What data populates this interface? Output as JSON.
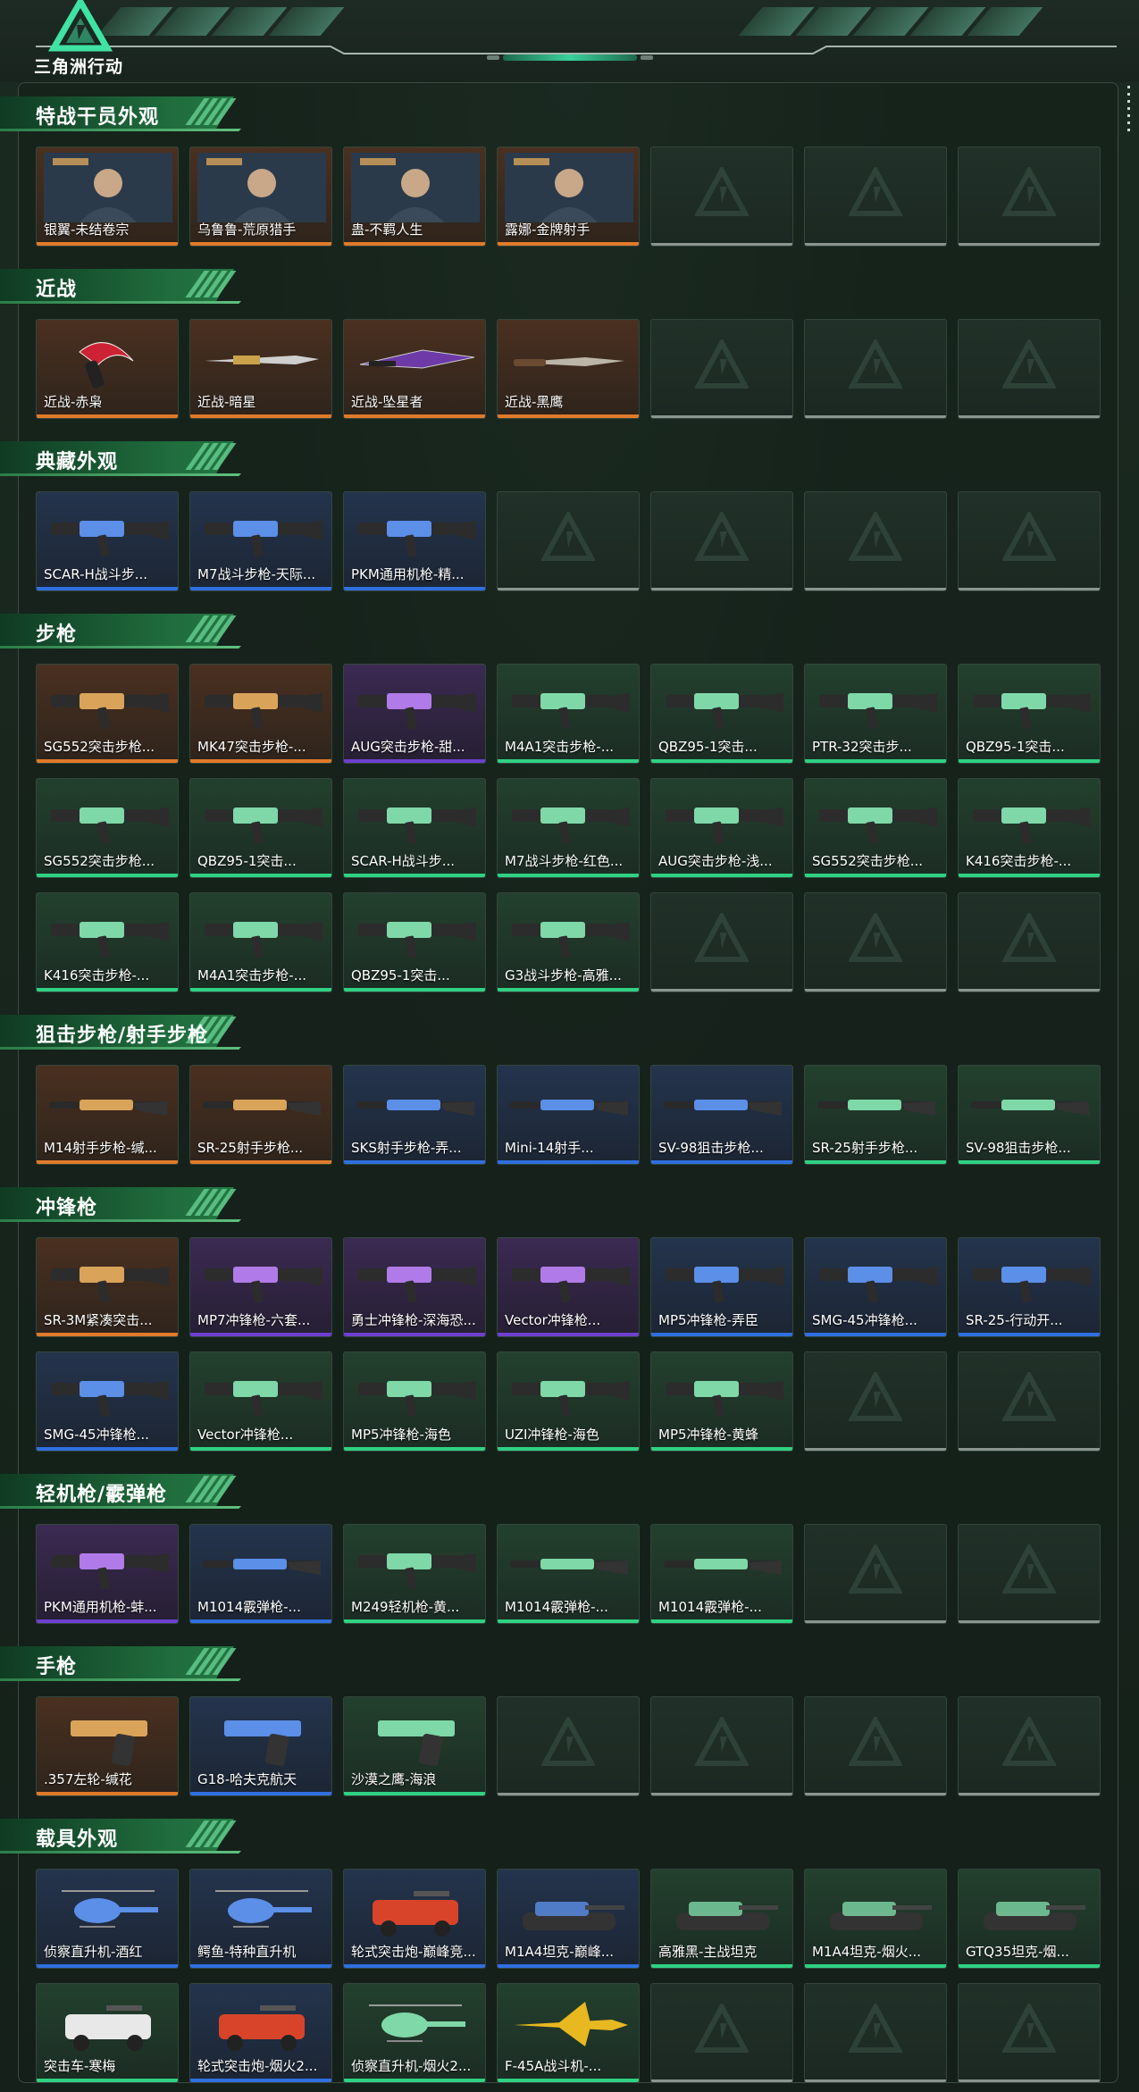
{
  "header": {
    "logo_text": "三角洲行动"
  },
  "colors": {
    "orange": "#e07a2a",
    "purple": "#6e3fd0",
    "blue": "#2f6fe0",
    "green": "#2fd183",
    "empty": "#8b9590",
    "accent": "#39d29c"
  },
  "sections": [
    {
      "title": "特战干员外观",
      "rows": 1,
      "items": [
        {
          "label": "银翼-未结卷宗",
          "rarity": "orange",
          "icon": "operator-portrait"
        },
        {
          "label": "乌鲁鲁-荒原猎手",
          "rarity": "orange",
          "icon": "operator-portrait"
        },
        {
          "label": "蛊-不羁人生",
          "rarity": "orange",
          "icon": "operator-portrait"
        },
        {
          "label": "露娜-金牌射手",
          "rarity": "orange",
          "icon": "operator-portrait"
        }
      ]
    },
    {
      "title": "近战",
      "rows": 1,
      "items": [
        {
          "label": "近战-赤枭",
          "rarity": "orange",
          "icon": "karambit-knife"
        },
        {
          "label": "近战-暗星",
          "rarity": "orange",
          "icon": "sword"
        },
        {
          "label": "近战-坠星者",
          "rarity": "orange",
          "icon": "blade"
        },
        {
          "label": "近战-黑鹰",
          "rarity": "orange",
          "icon": "combat-knife"
        }
      ]
    },
    {
      "title": "典藏外观",
      "rows": 1,
      "items": [
        {
          "label": "SCAR-H战斗步...",
          "rarity": "blue",
          "icon": "rifle"
        },
        {
          "label": "M7战斗步枪-天际...",
          "rarity": "blue",
          "icon": "rifle"
        },
        {
          "label": "PKM通用机枪-精...",
          "rarity": "blue",
          "icon": "machine-gun"
        }
      ]
    },
    {
      "title": "步枪",
      "rows": 3,
      "items": [
        {
          "label": "SG552突击步枪...",
          "rarity": "orange",
          "icon": "rifle"
        },
        {
          "label": "MK47突击步枪-...",
          "rarity": "orange",
          "icon": "rifle"
        },
        {
          "label": "AUG突击步枪-甜...",
          "rarity": "purple",
          "icon": "rifle"
        },
        {
          "label": "M4A1突击步枪-...",
          "rarity": "green",
          "icon": "rifle"
        },
        {
          "label": "QBZ95-1突击...",
          "rarity": "green",
          "icon": "rifle"
        },
        {
          "label": "PTR-32突击步...",
          "rarity": "green",
          "icon": "rifle"
        },
        {
          "label": "QBZ95-1突击...",
          "rarity": "green",
          "icon": "rifle"
        },
        {
          "label": "SG552突击步枪...",
          "rarity": "green",
          "icon": "rifle"
        },
        {
          "label": "QBZ95-1突击...",
          "rarity": "green",
          "icon": "rifle"
        },
        {
          "label": "SCAR-H战斗步...",
          "rarity": "green",
          "icon": "rifle"
        },
        {
          "label": "M7战斗步枪-红色...",
          "rarity": "green",
          "icon": "rifle"
        },
        {
          "label": "AUG突击步枪-浅...",
          "rarity": "green",
          "icon": "rifle"
        },
        {
          "label": "SG552突击步枪...",
          "rarity": "green",
          "icon": "rifle"
        },
        {
          "label": "K416突击步枪-...",
          "rarity": "green",
          "icon": "rifle"
        },
        {
          "label": "K416突击步枪-...",
          "rarity": "green",
          "icon": "rifle"
        },
        {
          "label": "M4A1突击步枪-...",
          "rarity": "green",
          "icon": "rifle"
        },
        {
          "label": "QBZ95-1突击...",
          "rarity": "green",
          "icon": "rifle"
        },
        {
          "label": "G3战斗步枪-高雅...",
          "rarity": "green",
          "icon": "rifle"
        }
      ]
    },
    {
      "title": "狙击步枪/射手步枪",
      "rows": 1,
      "items": [
        {
          "label": "M14射手步枪-缄...",
          "rarity": "orange",
          "icon": "marksman-rifle"
        },
        {
          "label": "SR-25射手步枪...",
          "rarity": "orange",
          "icon": "marksman-rifle"
        },
        {
          "label": "SKS射手步枪-弄...",
          "rarity": "blue",
          "icon": "marksman-rifle"
        },
        {
          "label": "Mini-14射手...",
          "rarity": "blue",
          "icon": "marksman-rifle"
        },
        {
          "label": "SV-98狙击步枪...",
          "rarity": "blue",
          "icon": "sniper-rifle"
        },
        {
          "label": "SR-25射手步枪...",
          "rarity": "green",
          "icon": "marksman-rifle"
        },
        {
          "label": "SV-98狙击步枪...",
          "rarity": "green",
          "icon": "sniper-rifle"
        }
      ]
    },
    {
      "title": "冲锋枪",
      "rows": 2,
      "items": [
        {
          "label": "SR-3M紧凑突击...",
          "rarity": "orange",
          "icon": "smg"
        },
        {
          "label": "MP7冲锋枪-六套...",
          "rarity": "purple",
          "icon": "smg"
        },
        {
          "label": "勇士冲锋枪-深海恐...",
          "rarity": "purple",
          "icon": "smg"
        },
        {
          "label": "Vector冲锋枪...",
          "rarity": "purple",
          "icon": "smg"
        },
        {
          "label": "MP5冲锋枪-弄臣",
          "rarity": "blue",
          "icon": "smg"
        },
        {
          "label": "SMG-45冲锋枪...",
          "rarity": "blue",
          "icon": "smg"
        },
        {
          "label": "SR-25-行动开...",
          "rarity": "blue",
          "icon": "smg"
        },
        {
          "label": "SMG-45冲锋枪...",
          "rarity": "blue",
          "icon": "smg"
        },
        {
          "label": "Vector冲锋枪...",
          "rarity": "green",
          "icon": "smg"
        },
        {
          "label": "MP5冲锋枪-海色",
          "rarity": "green",
          "icon": "smg"
        },
        {
          "label": "UZI冲锋枪-海色",
          "rarity": "green",
          "icon": "smg"
        },
        {
          "label": "MP5冲锋枪-黄蜂",
          "rarity": "green",
          "icon": "smg"
        }
      ]
    },
    {
      "title": "轻机枪/霰弹枪",
      "rows": 1,
      "items": [
        {
          "label": "PKM通用机枪-蚌...",
          "rarity": "purple",
          "icon": "machine-gun"
        },
        {
          "label": "M1014霰弹枪-...",
          "rarity": "blue",
          "icon": "shotgun"
        },
        {
          "label": "M249轻机枪-黄...",
          "rarity": "green",
          "icon": "machine-gun"
        },
        {
          "label": "M1014霰弹枪-...",
          "rarity": "green",
          "icon": "shotgun"
        },
        {
          "label": "M1014霰弹枪-...",
          "rarity": "green",
          "icon": "shotgun"
        }
      ]
    },
    {
      "title": "手枪",
      "rows": 1,
      "items": [
        {
          "label": ".357左轮-缄花",
          "rarity": "orange",
          "icon": "revolver"
        },
        {
          "label": "G18-哈夫克航天",
          "rarity": "blue",
          "icon": "pistol"
        },
        {
          "label": "沙漠之鹰-海浪",
          "rarity": "green",
          "icon": "pistol"
        }
      ]
    },
    {
      "title": "载具外观",
      "rows": 2,
      "items": [
        {
          "label": "侦察直升机-酒红",
          "rarity": "blue",
          "icon": "helicopter"
        },
        {
          "label": "鳄鱼-特种直升机",
          "rarity": "blue",
          "icon": "helicopter"
        },
        {
          "label": "轮式突击炮-巅峰竞...",
          "rarity": "blue",
          "icon": "armored-vehicle"
        },
        {
          "label": "M1A4坦克-巅峰...",
          "rarity": "blue",
          "icon": "tank"
        },
        {
          "label": "高雅黑-主战坦克",
          "rarity": "green",
          "icon": "tank"
        },
        {
          "label": "M1A4坦克-烟火...",
          "rarity": "green",
          "icon": "tank"
        },
        {
          "label": "GTQ35坦克-烟...",
          "rarity": "green",
          "icon": "tank"
        },
        {
          "label": "突击车-寒梅",
          "rarity": "green",
          "icon": "assault-vehicle"
        },
        {
          "label": "轮式突击炮-烟火2...",
          "rarity": "blue",
          "icon": "armored-vehicle"
        },
        {
          "label": "侦察直升机-烟火2...",
          "rarity": "green",
          "icon": "helicopter"
        },
        {
          "label": "F-45A战斗机-...",
          "rarity": "green",
          "icon": "fighter-jet"
        }
      ]
    }
  ]
}
